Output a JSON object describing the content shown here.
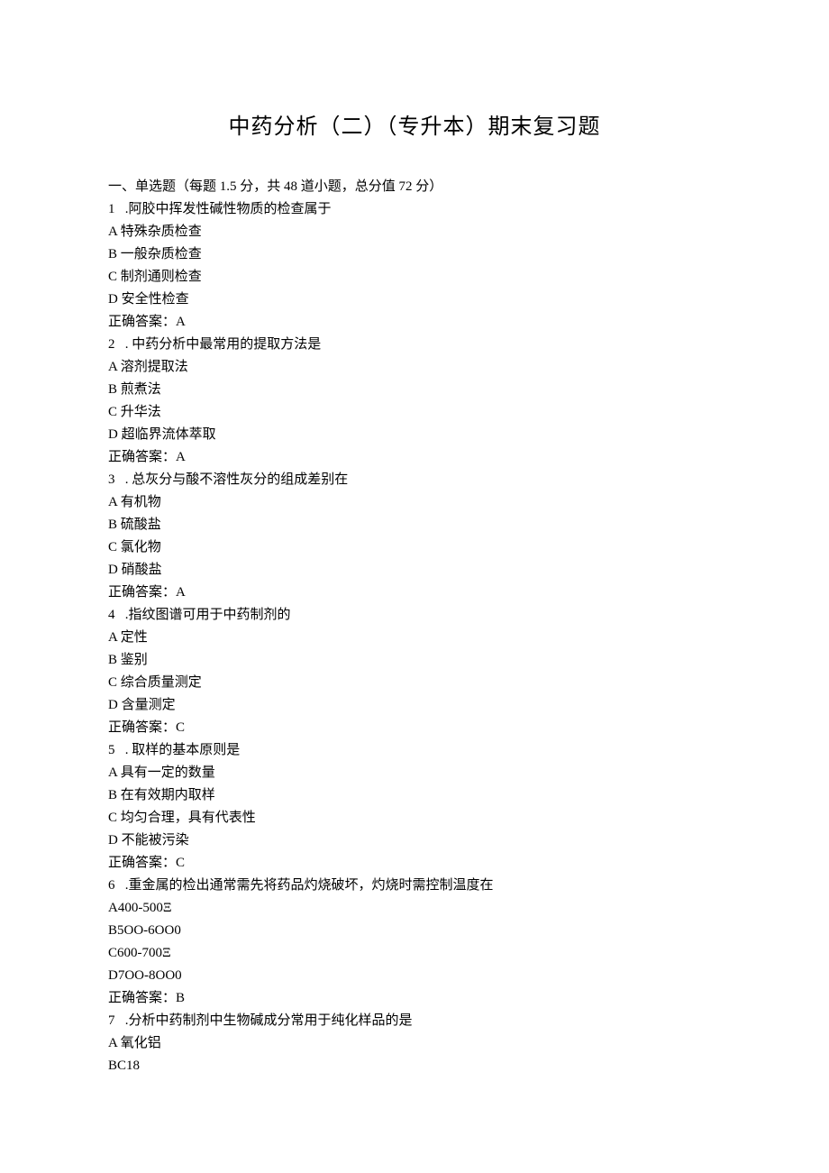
{
  "title": "中药分析（二）（专升本）期末复习题",
  "section_heading": "一、单选题（每题 1.5 分，共 48 道小题，总分值 72 分）",
  "questions": [
    {
      "stem": "1   .阿胶中挥发性碱性物质的检查属于",
      "options": [
        "A 特殊杂质检查",
        "B 一般杂质检查",
        "C 制剂通则检查",
        "D 安全性检查"
      ],
      "answer": "正确答案：A"
    },
    {
      "stem": "2   . 中药分析中最常用的提取方法是",
      "options": [
        "A 溶剂提取法",
        "B 煎煮法",
        "C 升华法",
        "D 超临界流体萃取"
      ],
      "answer": "正确答案：A"
    },
    {
      "stem": "3   . 总灰分与酸不溶性灰分的组成差别在",
      "options": [
        "A 有机物",
        "B 硫酸盐",
        "C 氯化物",
        "D 硝酸盐"
      ],
      "answer": "正确答案：A"
    },
    {
      "stem": "4   .指纹图谱可用于中药制剂的",
      "options": [
        "A 定性",
        "B 鉴别",
        "C 综合质量测定",
        "D 含量测定"
      ],
      "answer": "正确答案：C"
    },
    {
      "stem": "5   . 取样的基本原则是",
      "options": [
        "A 具有一定的数量",
        "B 在有效期内取样",
        "C 均匀合理，具有代表性",
        "D 不能被污染"
      ],
      "answer": "正确答案：C"
    },
    {
      "stem": "6   .重金属的检出通常需先将药品灼烧破坏，灼烧时需控制温度在",
      "options": [
        "A400-500Ξ",
        "B5OO-6OO0",
        "C600-700Ξ",
        "D7OO-8OO0"
      ],
      "answer": "正确答案：B"
    },
    {
      "stem": "7   .分析中药制剂中生物碱成分常用于纯化样品的是",
      "options": [
        "A 氧化铝",
        "BC18"
      ],
      "answer": ""
    }
  ]
}
